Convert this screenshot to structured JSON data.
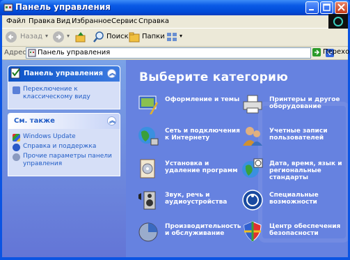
{
  "window": {
    "title": "Панель управления"
  },
  "menu": [
    {
      "label": "Файл"
    },
    {
      "label": "Правка"
    },
    {
      "label": "Вид"
    },
    {
      "label": "Избранное"
    },
    {
      "label": "Сервис"
    },
    {
      "label": "Справка"
    }
  ],
  "toolbar": {
    "back": "Назад",
    "search": "Поиск",
    "folders": "Папки"
  },
  "address": {
    "label": "Адрес:",
    "value": "Панель управления",
    "go": "Переход"
  },
  "sidebar": {
    "panel1": {
      "title": "Панель управления",
      "link": "Переключение к классическому виду"
    },
    "panel2": {
      "title": "См. также",
      "links": [
        {
          "label": "Windows Update"
        },
        {
          "label": "Справка и поддержка"
        },
        {
          "label": "Прочие параметры панели управления"
        }
      ]
    }
  },
  "main": {
    "heading": "Выберите категорию",
    "categories": [
      {
        "label": "Оформление и темы",
        "icon": "appearance-icon"
      },
      {
        "label": "Принтеры и другое оборудование",
        "icon": "printer-icon"
      },
      {
        "label": "Сеть и подключения к Интернету",
        "icon": "network-icon"
      },
      {
        "label": "Учетные записи пользователей",
        "icon": "users-icon"
      },
      {
        "label": "Установка и удаление программ",
        "icon": "programs-icon"
      },
      {
        "label": "Дата, время, язык и региональные стандарты",
        "icon": "datetime-icon"
      },
      {
        "label": "Звук, речь и аудиоустройства",
        "icon": "sound-icon"
      },
      {
        "label": "Специальные возможности",
        "icon": "accessibility-icon"
      },
      {
        "label": "Производительность и обслуживание",
        "icon": "performance-icon"
      },
      {
        "label": "Центр обеспечения безопасности",
        "icon": "security-icon"
      }
    ]
  },
  "colors": {
    "titlebar": "#0a54e3",
    "sidebar": "#7ba2e7",
    "main": "#6682e0",
    "link": "#215dc6"
  }
}
